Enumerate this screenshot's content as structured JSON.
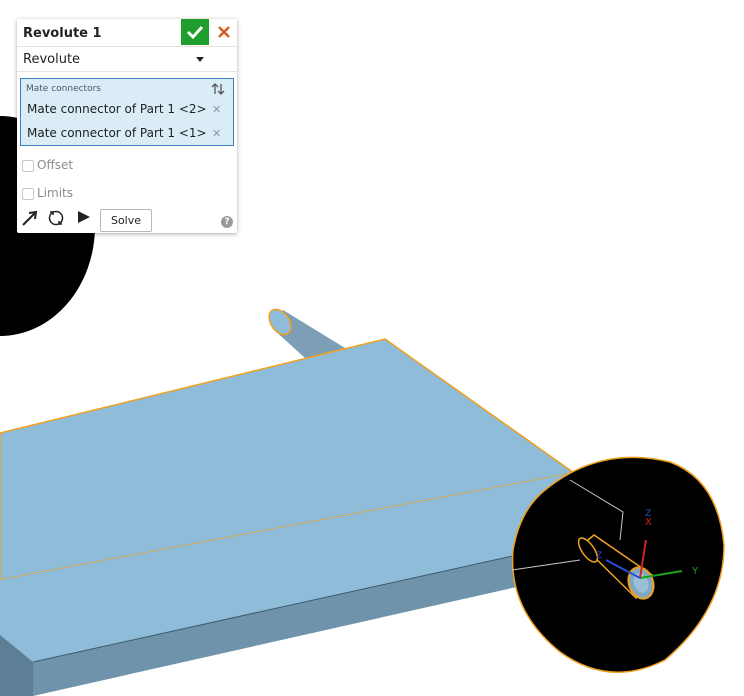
{
  "feature": {
    "title": "Revolute 1",
    "type_value": "Revolute",
    "mate_connectors_label": "Mate connectors",
    "mate_connectors": [
      "Mate connector of Part 1 <2>",
      "Mate connector of Part 1 <1>"
    ],
    "offset_label": "Offset",
    "limits_label": "Limits",
    "solve_label": "Solve",
    "help_glyph": "?"
  },
  "triad": {
    "x": "X",
    "y": "Y",
    "z": "Z"
  },
  "colors": {
    "accept": "#1f9e2e",
    "cancel": "#e05a2b",
    "selection_highlight": "#daedf6",
    "part_face": "#8fbcd8",
    "part_edge_highlight": "#f0a020"
  },
  "icons": [
    "check-icon",
    "close-icon",
    "chevron-down-icon",
    "sort-icon",
    "remove-icon",
    "arrow-tool-icon",
    "rotate-tool-icon",
    "play-icon",
    "help-icon"
  ]
}
